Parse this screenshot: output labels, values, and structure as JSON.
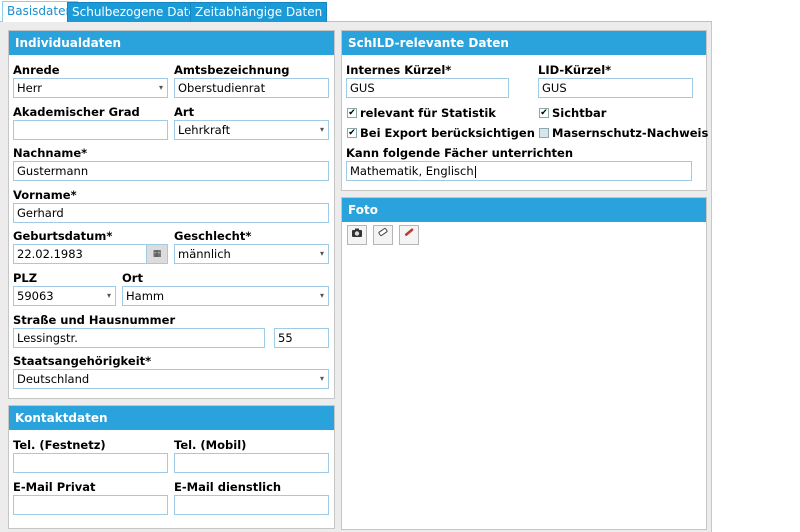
{
  "tabs": [
    "Basisdaten",
    "Schulbezogene Daten",
    "Zeitabhängige Daten"
  ],
  "individual": {
    "title": "Individualdaten",
    "anrede_label": "Anrede",
    "anrede_value": "Herr",
    "amts_label": "Amtsbezeichnung",
    "amts_value": "Oberstudienrat",
    "grad_label": "Akademischer Grad",
    "grad_value": "",
    "art_label": "Art",
    "art_value": "Lehrkraft",
    "nachname_label": "Nachname*",
    "nachname_value": "Gustermann",
    "vorname_label": "Vorname*",
    "vorname_value": "Gerhard",
    "geb_label": "Geburtsdatum*",
    "geb_value": "22.02.1983",
    "geschlecht_label": "Geschlecht*",
    "geschlecht_value": "männlich",
    "plz_label": "PLZ",
    "plz_value": "59063",
    "ort_label": "Ort",
    "ort_value": "Hamm",
    "strasse_label": "Straße und Hausnummer",
    "strasse_value": "Lessingstr.",
    "hausnr_value": "55",
    "staat_label": "Staatsangehörigkeit*",
    "staat_value": "Deutschland"
  },
  "contact": {
    "title": "Kontaktdaten",
    "tel_label": "Tel. (Festnetz)",
    "tel_value": "",
    "mobil_label": "Tel. (Mobil)",
    "mobil_value": "",
    "mail_privat_label": "E-Mail Privat",
    "mail_privat_value": "",
    "mail_dienst_label": "E-Mail dienstlich",
    "mail_dienst_value": ""
  },
  "schild": {
    "title": "SchILD-relevante Daten",
    "kuerzel_label": "Internes Kürzel*",
    "kuerzel_value": "GUS",
    "lid_label": "LID-Kürzel*",
    "lid_value": "GUS",
    "statistik_label": "relevant für Statistik",
    "statistik_checked": true,
    "sichtbar_label": "Sichtbar",
    "sichtbar_checked": true,
    "export_label": "Bei Export berücksichtigen",
    "export_checked": true,
    "masern_label": "Masernschutz-Nachweis",
    "masern_checked": false,
    "faecher_label": "Kann folgende Fächer unterrichten",
    "faecher_value": "Mathematik, Englisch"
  },
  "foto": {
    "title": "Foto",
    "tools": [
      "camera-icon",
      "eraser-icon",
      "pen-icon"
    ]
  },
  "icons": {
    "dropdown": "▾",
    "calendar": "▦",
    "check": "✔"
  },
  "colors": {
    "accent": "#2aa2dc",
    "tab": "#1a9bd7"
  }
}
